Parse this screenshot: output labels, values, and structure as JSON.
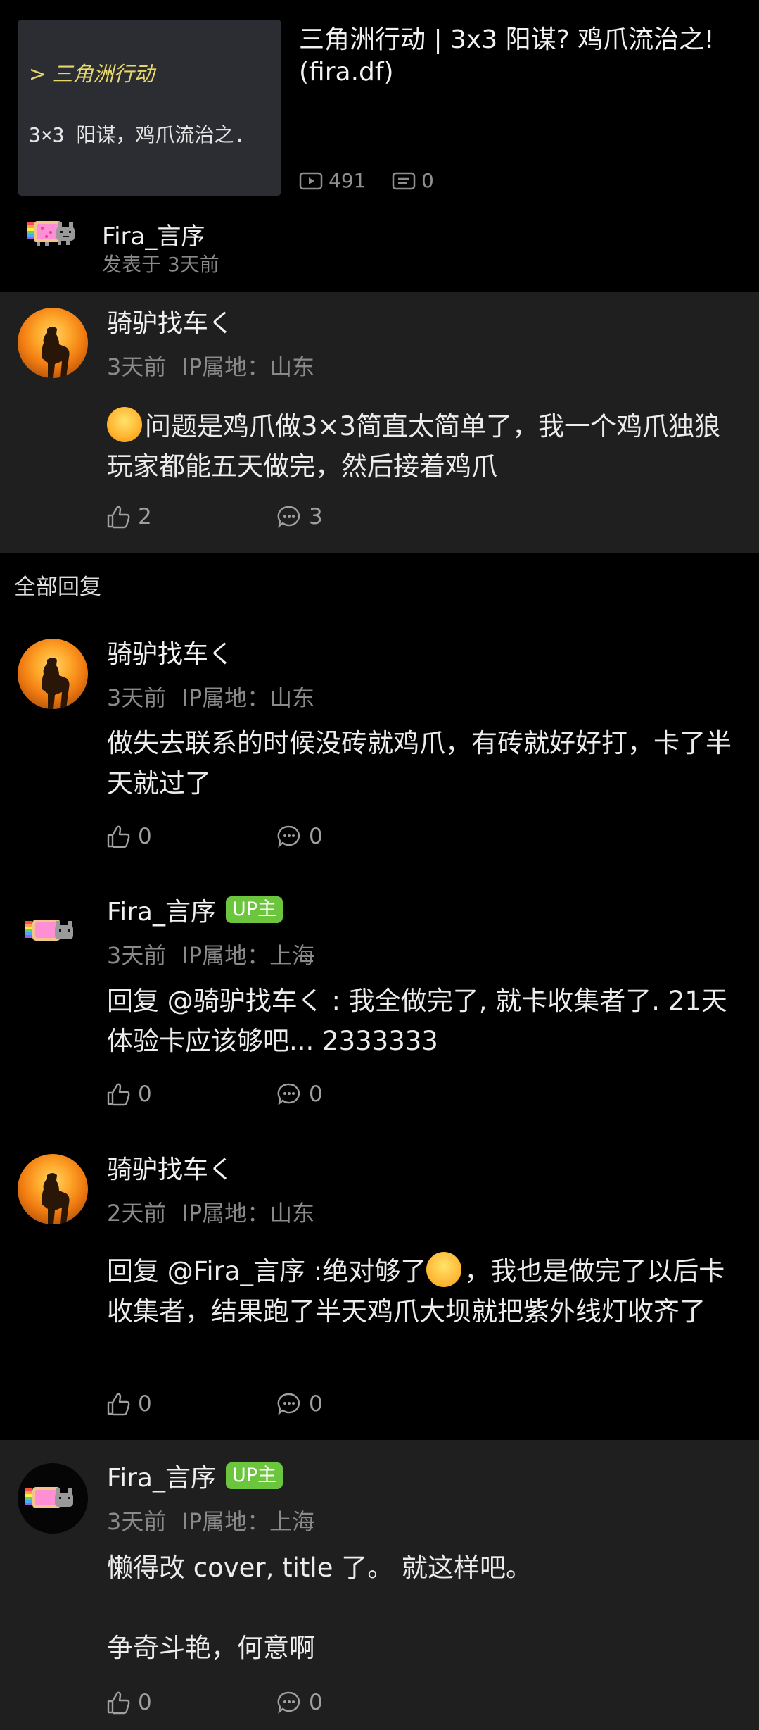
{
  "video": {
    "thumb_tag": "> 三角洲行动",
    "thumb_sub": "3×3 阳谋，鸡爪流治之.",
    "title": "三角洲行动 | 3x3 阳谋? 鸡爪流治之! (fira.df)",
    "views": "491",
    "comments": "0"
  },
  "author": {
    "name": "Fira_言序",
    "posted": "发表于 3天前"
  },
  "main_comment": {
    "user": "骑驴找车く",
    "time": "3天前",
    "ip": "IP属地：山东",
    "text": "问题是鸡爪做3×3简直太简单了，我一个鸡爪独狼玩家都能五天做完，然后接着鸡爪",
    "likes": "2",
    "replies": "3"
  },
  "section_title": "全部回复",
  "replies": [
    {
      "user": "骑驴找车く",
      "time": "3天前",
      "ip": "IP属地：山东",
      "text": "做失去联系的时候没砖就鸡爪，有砖就好好打，卡了半天就过了",
      "likes": "0",
      "replies": "0"
    },
    {
      "user": "Fira_言序",
      "badge": "UP主",
      "time": "3天前",
      "ip": "IP属地：上海",
      "text": "回复 @骑驴找车く : 我全做完了, 就卡收集者了. 21天体验卡应该够吧... 2333333",
      "likes": "0",
      "replies": "0"
    },
    {
      "user": "骑驴找车く",
      "time": "2天前",
      "ip": "IP属地：山东",
      "text_a": "回复 @Fira_言序 :绝对够了",
      "text_b": "，我也是做完了以后卡收集者，结果跑了半天鸡爪大坝就把紫外线灯收齐了",
      "likes": "0",
      "replies": "0"
    }
  ],
  "pinned": {
    "user": "Fira_言序",
    "badge": "UP主",
    "time": "3天前",
    "ip": "IP属地：上海",
    "line1": "懒得改 cover, title 了。 就这样吧。",
    "line2": "争奇斗艳，何意啊",
    "likes": "0",
    "replies": "0"
  }
}
